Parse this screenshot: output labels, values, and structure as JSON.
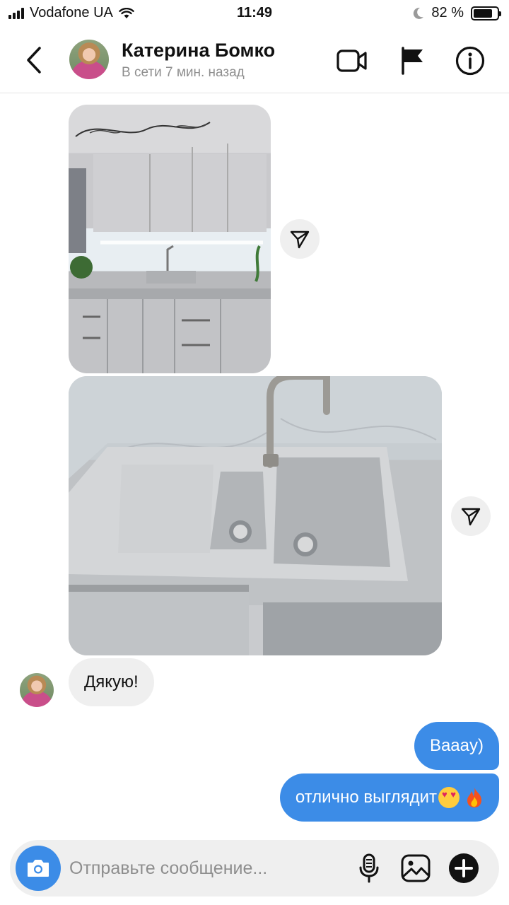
{
  "status_bar": {
    "carrier": "Vodafone UA",
    "time": "11:49",
    "battery": "82 %",
    "battery_level": 0.82
  },
  "header": {
    "contact_name": "Катерина Бомко",
    "contact_status": "В сети 7 мин. назад",
    "icons": [
      "back-icon",
      "video-call-icon",
      "flag-icon",
      "info-icon"
    ]
  },
  "messages": {
    "incoming_text": "Дякую!",
    "outgoing": [
      {
        "text": "Вaaay)"
      },
      {
        "text": "отлично выглядит",
        "emoji": [
          "heart-eyes-emoji",
          "fire-emoji"
        ]
      }
    ]
  },
  "composer": {
    "placeholder": "Отправьте сообщение...",
    "icons": [
      "camera-icon",
      "microphone-icon",
      "gallery-icon",
      "plus-icon"
    ]
  },
  "colors": {
    "accent": "#3c8ce7",
    "bubble_in": "#efefef",
    "secondary_text": "#8e8e8e"
  }
}
